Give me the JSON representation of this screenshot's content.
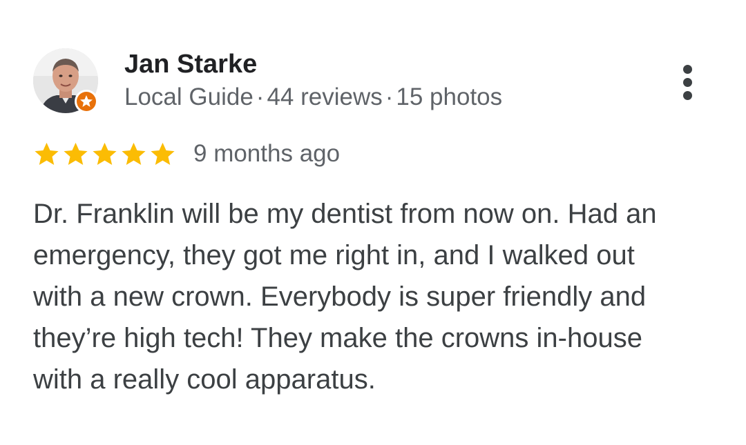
{
  "reviewer": {
    "name": "Jan Starke",
    "badge": "Local Guide",
    "separator": "·",
    "reviews": "44 reviews",
    "photos": "15 photos"
  },
  "rating": {
    "stars": 5,
    "max_stars": 5,
    "time_ago": "9 months ago"
  },
  "review_text_lines": [
    "Dr. Franklin will be my dentist from now on. Had an",
    "emergency, they got me right in, and I walked out",
    "with a new crown. Everybody is super friendly and",
    "they’re high tech! They make the crowns in-house",
    "with a really cool apparatus."
  ],
  "icons": {
    "more": "more-vert-icon",
    "star": "star-icon",
    "badge": "local-guide-star-icon"
  },
  "colors": {
    "name": "#202124",
    "meta": "#5f6368",
    "body": "#3c4043",
    "star": "#fbbc04",
    "badge": "#e8710a"
  }
}
